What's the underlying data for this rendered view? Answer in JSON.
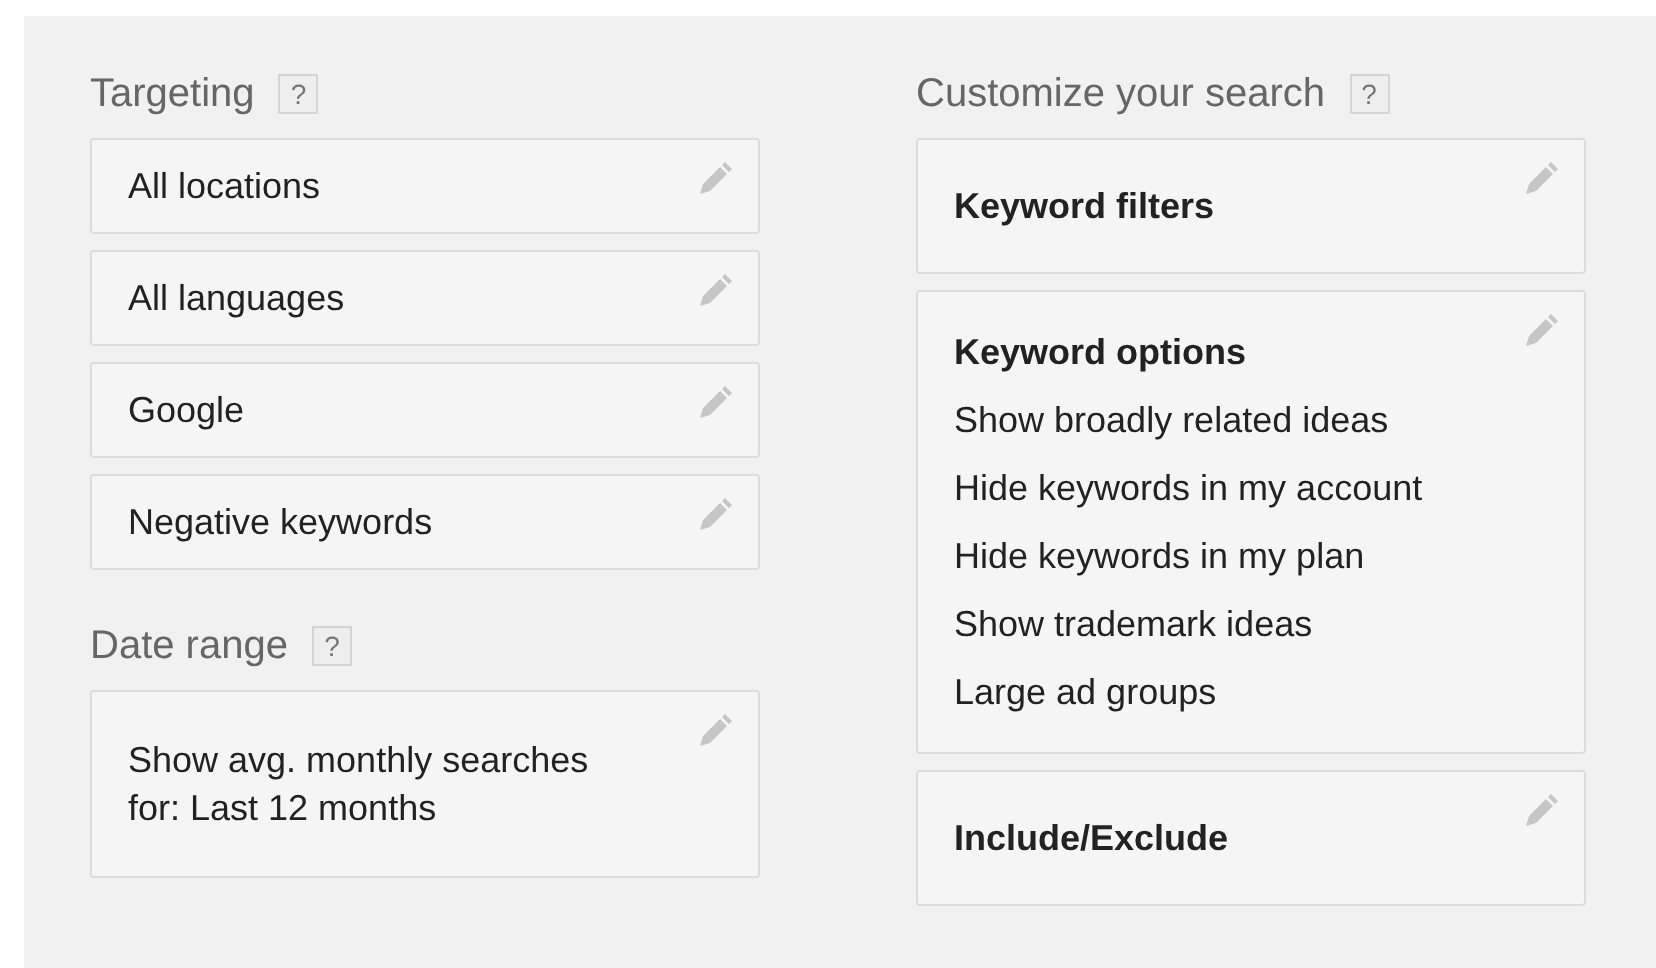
{
  "left_column": [
    {
      "heading": "Targeting",
      "help": "?",
      "cards": [
        {
          "kind": "plain",
          "lines": [
            "All locations"
          ]
        },
        {
          "kind": "plain",
          "lines": [
            "All languages"
          ]
        },
        {
          "kind": "plain",
          "lines": [
            "Google"
          ]
        },
        {
          "kind": "plain",
          "lines": [
            "Negative keywords"
          ]
        }
      ]
    },
    {
      "heading": "Date range",
      "help": "?",
      "cards": [
        {
          "kind": "plain",
          "lines": [
            "Show avg. monthly searches for: Last 12 months"
          ]
        }
      ]
    }
  ],
  "right_column": [
    {
      "heading": "Customize your search",
      "help": "?",
      "cards": [
        {
          "kind": "titled",
          "title": "Keyword filters"
        },
        {
          "kind": "titled",
          "title": "Keyword options",
          "lines": [
            "Show broadly related ideas",
            "Hide keywords in my account",
            "Hide keywords in my plan",
            "Show trademark ideas",
            "Large ad groups"
          ]
        },
        {
          "kind": "titled",
          "title": "Include/Exclude"
        }
      ]
    }
  ]
}
